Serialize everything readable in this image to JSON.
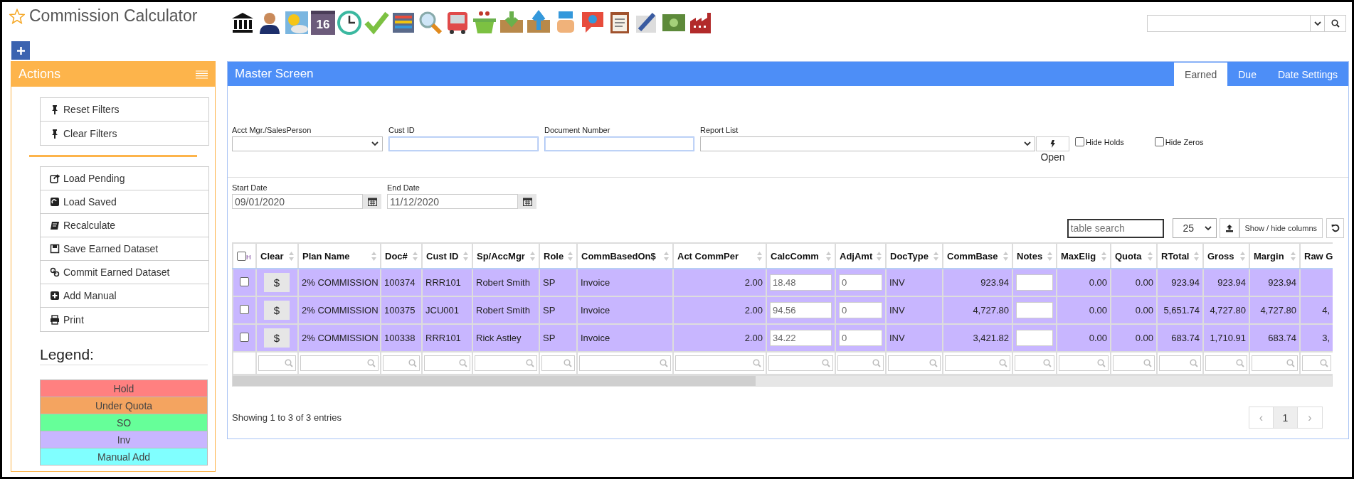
{
  "title": "Commission Calculator",
  "toolbar": {
    "calendar_day": "16"
  },
  "actions": {
    "title": "Actions",
    "groups": [
      [
        "Reset Filters",
        "Clear Filters"
      ],
      [
        "Load Pending",
        "Load Saved",
        "Recalculate",
        "Save Earned Dataset",
        "Commit Earned Dataset",
        "Add Manual",
        "Print"
      ]
    ]
  },
  "legend": {
    "title": "Legend:",
    "items": [
      {
        "label": "Hold",
        "color": "#ff8080"
      },
      {
        "label": "Under Quota",
        "color": "#f4a460"
      },
      {
        "label": "SO",
        "color": "#66ff99"
      },
      {
        "label": "Inv",
        "color": "#c8b6ff"
      },
      {
        "label": "Manual Add",
        "color": "#80ffff"
      }
    ]
  },
  "master": {
    "title": "Master Screen",
    "tabs": [
      {
        "label": "Earned",
        "selected": true
      },
      {
        "label": "Due",
        "selected": false
      },
      {
        "label": "Date Settings",
        "selected": false
      }
    ],
    "filters": {
      "salesperson_label": "Acct Mgr./SalesPerson",
      "cust_id_label": "Cust ID",
      "document_number_label": "Document Number",
      "report_list_label": "Report List",
      "open_button": "Open",
      "hide_holds": {
        "label": "Hide Holds",
        "checked": false
      },
      "hide_zeros": {
        "label": "Hide Zeros",
        "checked": false
      },
      "start_date_label": "Start Date",
      "start_date": "09/01/2020",
      "end_date_label": "End Date",
      "end_date": "11/12/2020"
    },
    "table_search": {
      "placeholder": "table search"
    },
    "page_length": "25",
    "show_hide_columns": "Show / hide columns",
    "table": {
      "select_all": {
        "checked": false
      },
      "columns": [
        {
          "label": "H",
          "kind": "check"
        },
        {
          "label": "Clear",
          "kind": "button"
        },
        {
          "label": "Plan Name",
          "kind": "text"
        },
        {
          "label": "Doc#",
          "kind": "text"
        },
        {
          "label": "Cust ID",
          "kind": "text"
        },
        {
          "label": "Sp/AccMgr",
          "kind": "text"
        },
        {
          "label": "Role",
          "kind": "text"
        },
        {
          "label": "CommBasedOn$",
          "kind": "text"
        },
        {
          "label": "Act CommPer",
          "kind": "number"
        },
        {
          "label": "CalcComm",
          "kind": "input"
        },
        {
          "label": "AdjAmt",
          "kind": "input"
        },
        {
          "label": "DocType",
          "kind": "text"
        },
        {
          "label": "CommBase",
          "kind": "number"
        },
        {
          "label": "Notes",
          "kind": "input"
        },
        {
          "label": "MaxElig",
          "kind": "number"
        },
        {
          "label": "Quota",
          "kind": "number"
        },
        {
          "label": "RTotal",
          "kind": "number"
        },
        {
          "label": "Gross",
          "kind": "number"
        },
        {
          "label": "Margin",
          "kind": "number"
        },
        {
          "label": "Raw G",
          "kind": "number"
        }
      ],
      "rows": [
        {
          "checked": false,
          "color": "#c8b6ff",
          "cells": [
            null,
            "$",
            "2% COMMISSION",
            "100374",
            "RRR101",
            "Robert Smith",
            "SP",
            "Invoice",
            "2.00",
            "18.48",
            "0",
            "INV",
            "923.94",
            null,
            "0.00",
            "0.00",
            "923.94",
            "923.94",
            "923.94",
            null
          ]
        },
        {
          "checked": false,
          "color": "#c8b6ff",
          "cells": [
            null,
            "$",
            "2% COMMISSION",
            "100375",
            "JCU001",
            "Robert Smith",
            "SP",
            "Invoice",
            "2.00",
            "94.56",
            "0",
            "INV",
            "4,727.80",
            null,
            "0.00",
            "0.00",
            "5,651.74",
            "4,727.80",
            "4,727.80",
            "4,"
          ]
        },
        {
          "checked": false,
          "color": "#c8b6ff",
          "cells": [
            null,
            "$",
            "2% COMMISSION",
            "100338",
            "RRR101",
            "Rick Astley",
            "SP",
            "Invoice",
            "2.00",
            "34.22",
            "0",
            "INV",
            "3,421.82",
            null,
            "0.00",
            "0.00",
            "683.74",
            "1,710.91",
            "683.74",
            "3,"
          ]
        }
      ]
    },
    "info": "Showing 1 to 3 of 3 entries",
    "pagination": [
      {
        "label": "‹",
        "kind": "prev",
        "selected": false
      },
      {
        "label": "1",
        "kind": "page",
        "selected": true
      },
      {
        "label": "›",
        "kind": "next",
        "selected": false
      }
    ]
  }
}
